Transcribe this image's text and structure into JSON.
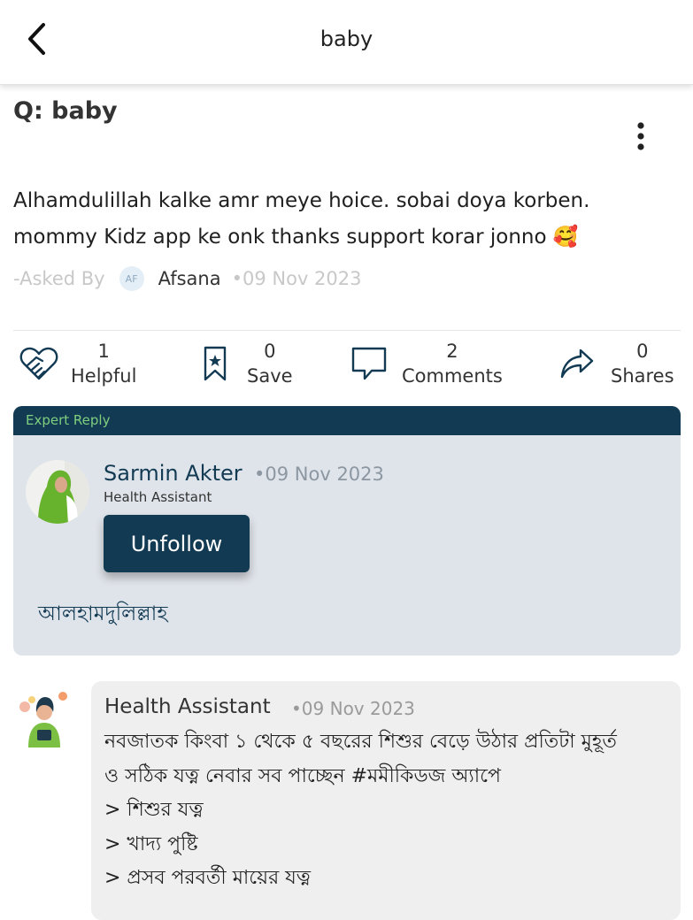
{
  "header": {
    "title": "baby",
    "back_icon": "chevron-left-icon"
  },
  "question": {
    "title": "Q: baby",
    "body": "Alhamdulillah kalke amr meye hoice. sobai doya korben. mommy Kidz app ke onk thanks support korar jonno 🥰",
    "asked_by_label": "-Asked By",
    "asker_initials": "AF",
    "asker_name": "Afsana",
    "date": "•09 Nov 2023",
    "more_icon": "vertical-dots-icon"
  },
  "actions": {
    "helpful": {
      "count": "1",
      "label": "Helpful",
      "icon": "handshake-heart-icon"
    },
    "save": {
      "count": "0",
      "label": "Save",
      "icon": "bookmark-star-icon"
    },
    "comments": {
      "count": "2",
      "label": "Comments",
      "icon": "comment-bubble-icon"
    },
    "shares": {
      "count": "0",
      "label": "Shares",
      "icon": "share-arrow-icon"
    }
  },
  "expert_reply": {
    "header_label": "Expert Reply",
    "name": "Sarmin Akter",
    "date": "•09 Nov 2023",
    "role": "Health Assistant",
    "unfollow_label": "Unfollow",
    "reply_text": "আলহামদুলিল্লাহ"
  },
  "comment": {
    "author": "Health Assistant",
    "date": "•09 Nov 2023",
    "lines": [
      "নবজাতক কিংবা ১ থেকে ৫ বছরের  শিশুর বেড়ে উঠার প্রতিটা মুহূর্ত",
      "ও সঠিক যত্ন নেবার সব পাচ্ছেন #মমীকিডজ অ্যাপে",
      "> শিশুর যত্ন",
      "> খাদ্য পুষ্টি",
      "> প্রসব পরবর্তী মায়ের যত্ন"
    ]
  },
  "colors": {
    "primary": "#123a53",
    "expert_label": "#7fcf7f",
    "expert_card_bg": "#dfe4ea",
    "comment_bg": "#efefef",
    "muted_text": "#c8c8c8"
  }
}
